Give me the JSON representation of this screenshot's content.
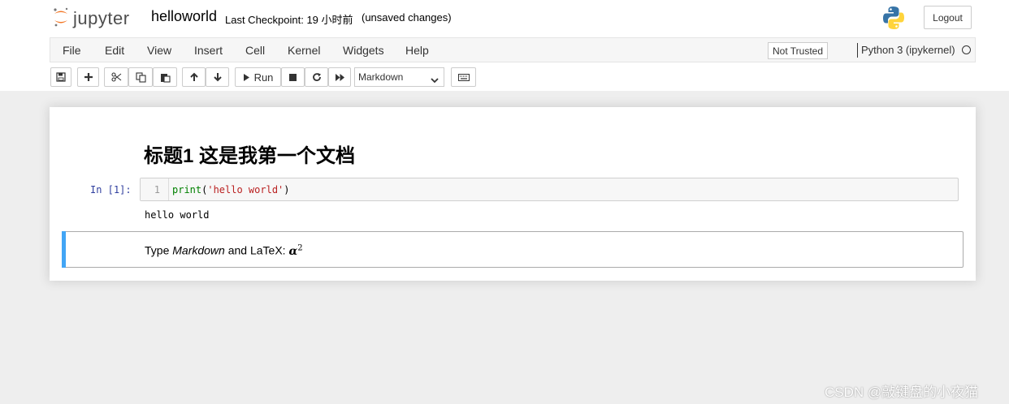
{
  "header": {
    "logo_text": "jupyter",
    "notebook_name": "helloworld",
    "checkpoint": "Last Checkpoint: 19 小时前",
    "unsaved": "(unsaved changes)",
    "logout_label": "Logout"
  },
  "menubar": {
    "items": [
      "File",
      "Edit",
      "View",
      "Insert",
      "Cell",
      "Kernel",
      "Widgets",
      "Help"
    ],
    "trust_label": "Not Trusted",
    "kernel_name": "Python 3 (ipykernel)"
  },
  "toolbar": {
    "run_label": "Run",
    "cell_type": "Markdown"
  },
  "cells": {
    "heading": "标题1 这是我第一个文档",
    "code_prompt": "In  [1]:",
    "line_number": "1",
    "code_fn": "print",
    "code_open": "(",
    "code_string": "'hello world'",
    "code_close": ")",
    "output": "hello world",
    "markdown_pre": "Type ",
    "markdown_em": "Markdown",
    "markdown_mid": " and LaTeX: ",
    "markdown_math": "α",
    "markdown_sup": "2"
  },
  "watermark": "CSDN @敲键盘的小夜猫",
  "colors": {
    "accent_blue": "#42a5f5",
    "prompt_blue": "#303f9f",
    "jupyter_orange": "#f37726"
  }
}
